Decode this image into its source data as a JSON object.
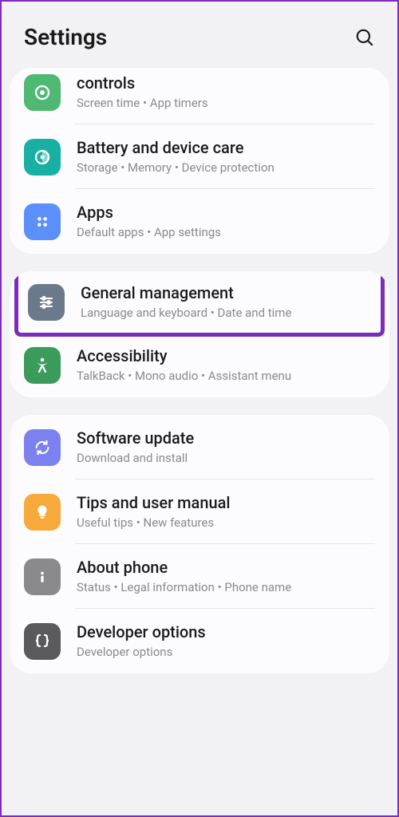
{
  "header": {
    "title": "Settings"
  },
  "groups": [
    {
      "items": [
        {
          "title": "controls",
          "subtitle": "Screen time  •  App timers"
        },
        {
          "title": "Battery and device care",
          "subtitle": "Storage  •  Memory  •  Device protection"
        },
        {
          "title": "Apps",
          "subtitle": "Default apps  •  App settings"
        }
      ]
    },
    {
      "items": [
        {
          "title": "General management",
          "subtitle": "Language and keyboard  •  Date and time"
        },
        {
          "title": "Accessibility",
          "subtitle": "TalkBack  •  Mono audio  •  Assistant menu"
        }
      ]
    },
    {
      "items": [
        {
          "title": "Software update",
          "subtitle": "Download and install"
        },
        {
          "title": "Tips and user manual",
          "subtitle": "Useful tips  •  New features"
        },
        {
          "title": "About phone",
          "subtitle": "Status  •  Legal information  •  Phone name"
        },
        {
          "title": "Developer options",
          "subtitle": "Developer options"
        }
      ]
    }
  ]
}
